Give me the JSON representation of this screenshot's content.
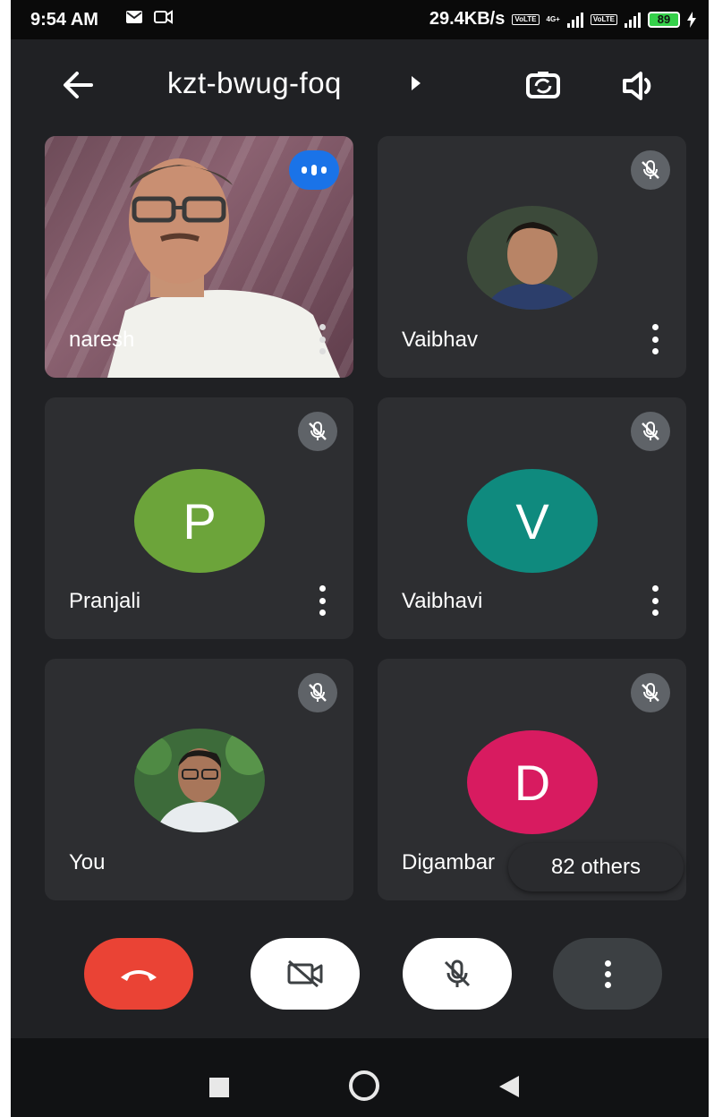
{
  "status_bar": {
    "time": "9:54 AM",
    "network_speed": "29.4KB/s",
    "network_type": "4G+",
    "volte": "VoLTE",
    "battery": "89"
  },
  "header": {
    "meeting_code": "kzt-bwug-foq"
  },
  "participants": [
    {
      "name": "naresh",
      "video": true,
      "speaking": true,
      "muted": false
    },
    {
      "name": "Vaibhav",
      "muted": true,
      "avatar": "photo"
    },
    {
      "name": "Pranjali",
      "muted": true,
      "avatar_letter": "P",
      "avatar_color": "#6ca43a"
    },
    {
      "name": "Vaibhavi",
      "muted": true,
      "avatar_letter": "V",
      "avatar_color": "#0f8a7e"
    },
    {
      "name": "You",
      "muted": true,
      "avatar": "photo"
    },
    {
      "name": "Digambar",
      "muted": true,
      "avatar_letter": "D",
      "avatar_color": "#d81b60"
    }
  ],
  "others_chip": "82 others",
  "controls": {
    "hangup": "end-call",
    "camera": "camera-off",
    "mic": "mic-off",
    "more": "more-options"
  },
  "colors": {
    "background": "#202124",
    "tile": "#2d2e31",
    "accent_blue": "#1a73e8",
    "hangup_red": "#ea4335"
  }
}
